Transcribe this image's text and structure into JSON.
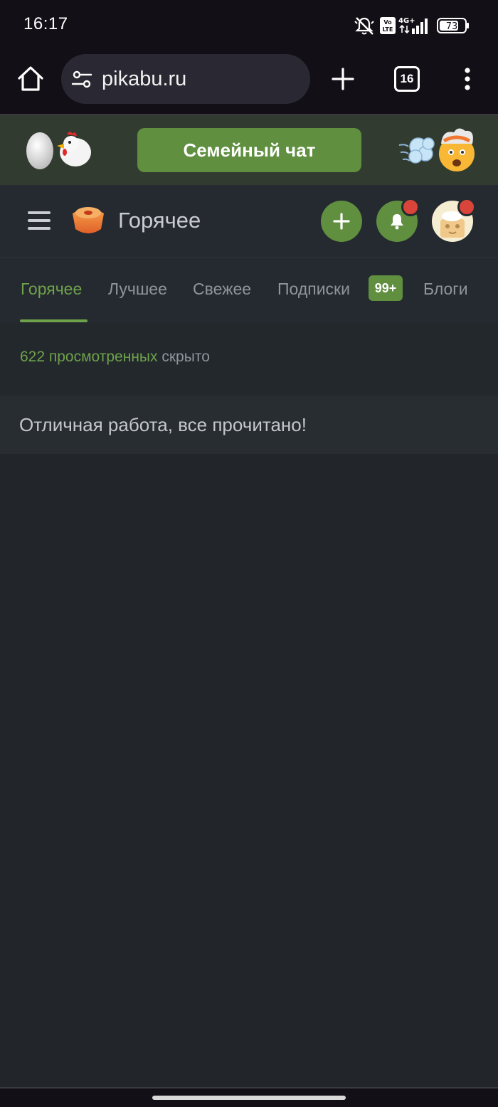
{
  "status_bar": {
    "time": "16:17",
    "battery": "73",
    "network": "4G+",
    "volte": "Vo LTE",
    "icons": [
      "mute-icon",
      "volte-icon",
      "signal-icon",
      "battery-icon"
    ]
  },
  "browser": {
    "url": "pikabu.ru",
    "tab_count": "16",
    "icons": [
      "home-icon",
      "site-settings-icon",
      "new-tab-icon",
      "tabs-icon",
      "more-menu-icon"
    ]
  },
  "promo": {
    "button_label": "Семейный чат",
    "left_emoji": "🥚🐔",
    "right_emoji": "💨🤯"
  },
  "header": {
    "title": "Горячее",
    "icons": [
      "hamburger-menu-icon",
      "hot-logo-icon",
      "add-post-icon",
      "bell-icon",
      "avatar"
    ]
  },
  "tabs": [
    {
      "label": "Горячее",
      "active": true
    },
    {
      "label": "Лучшее",
      "active": false
    },
    {
      "label": "Свежее",
      "active": false
    },
    {
      "label": "Подписки",
      "active": false,
      "badge": "99+"
    },
    {
      "label": "Блоги",
      "active": false
    }
  ],
  "feed": {
    "hidden_count_text": "622 просмотренных",
    "hidden_suffix": " скрыто",
    "all_read_message": "Отличная работа, все прочитано!"
  },
  "colors": {
    "accent": "#6ea24a",
    "button_green": "#5f8f3f",
    "notification_red": "#d9453a",
    "background": "#22262b"
  }
}
